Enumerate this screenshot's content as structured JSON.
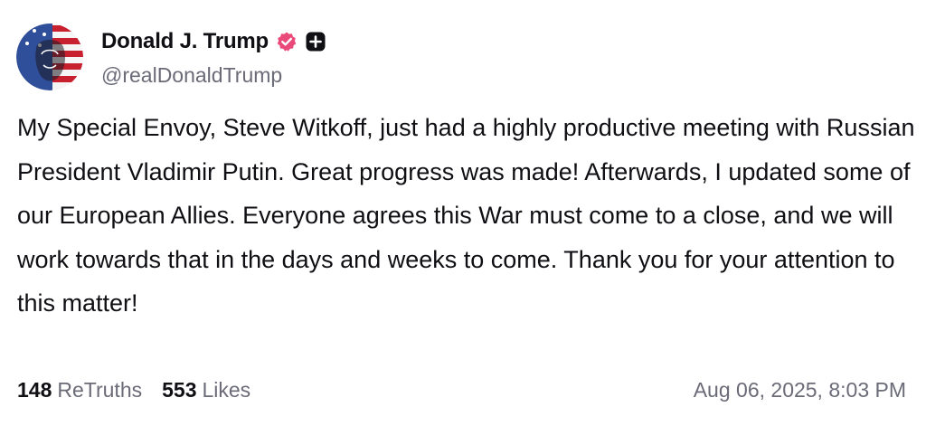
{
  "post": {
    "author": {
      "display_name": "Donald J. Trump",
      "handle": "@realDonaldTrump",
      "verified_icon": "verified-badge-icon",
      "plus_icon": "plus-badge-icon"
    },
    "text": "My Special Envoy, Steve Witkoff, just had a highly productive meeting with Russian President Vladimir Putin. Great progress was made! Afterwards, I updated some of our European Allies. Everyone agrees this War must come to a close, and we will work towards that in the days and weeks to come. Thank you for your attention to this matter!",
    "stats": {
      "retruths_count": "148",
      "retruths_label": "ReTruths",
      "likes_count": "553",
      "likes_label": "Likes"
    },
    "timestamp": "Aug 06, 2025, 8:03 PM"
  },
  "colors": {
    "verified_badge": "#ea4a7a",
    "text_primary": "#0f0f14",
    "text_secondary": "#6b6b78",
    "background": "#ffffff"
  }
}
